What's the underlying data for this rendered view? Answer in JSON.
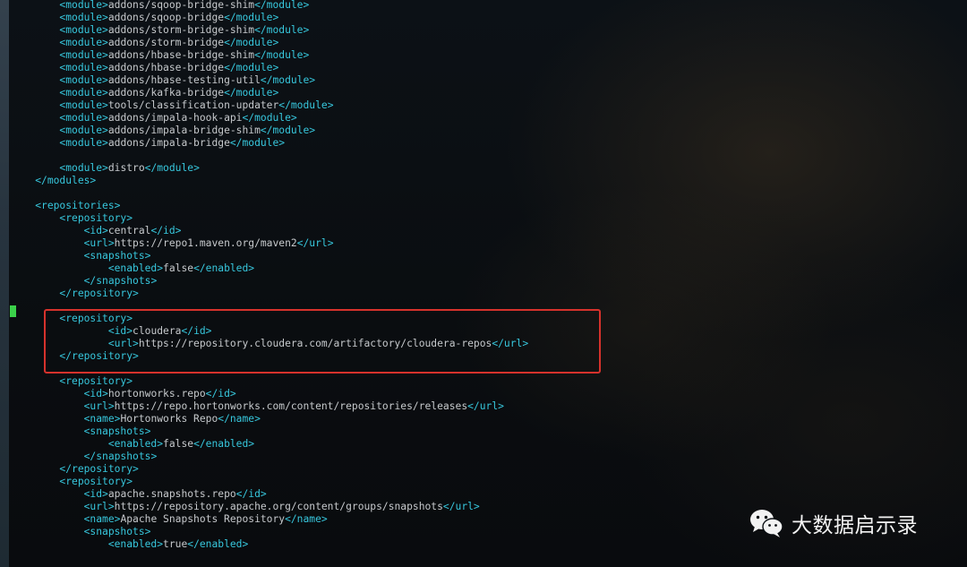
{
  "terminal": {
    "lines": [
      {
        "indent": "        ",
        "parts": [
          [
            "t",
            "<module>"
          ],
          [
            "x",
            "addons/sqoop-bridge-shim"
          ],
          [
            "t",
            "</module>"
          ]
        ]
      },
      {
        "indent": "        ",
        "parts": [
          [
            "t",
            "<module>"
          ],
          [
            "x",
            "addons/sqoop-bridge"
          ],
          [
            "t",
            "</module>"
          ]
        ]
      },
      {
        "indent": "        ",
        "parts": [
          [
            "t",
            "<module>"
          ],
          [
            "x",
            "addons/storm-bridge-shim"
          ],
          [
            "t",
            "</module>"
          ]
        ]
      },
      {
        "indent": "        ",
        "parts": [
          [
            "t",
            "<module>"
          ],
          [
            "x",
            "addons/storm-bridge"
          ],
          [
            "t",
            "</module>"
          ]
        ]
      },
      {
        "indent": "        ",
        "parts": [
          [
            "t",
            "<module>"
          ],
          [
            "x",
            "addons/hbase-bridge-shim"
          ],
          [
            "t",
            "</module>"
          ]
        ]
      },
      {
        "indent": "        ",
        "parts": [
          [
            "t",
            "<module>"
          ],
          [
            "x",
            "addons/hbase-bridge"
          ],
          [
            "t",
            "</module>"
          ]
        ]
      },
      {
        "indent": "        ",
        "parts": [
          [
            "t",
            "<module>"
          ],
          [
            "x",
            "addons/hbase-testing-util"
          ],
          [
            "t",
            "</module>"
          ]
        ]
      },
      {
        "indent": "        ",
        "parts": [
          [
            "t",
            "<module>"
          ],
          [
            "x",
            "addons/kafka-bridge"
          ],
          [
            "t",
            "</module>"
          ]
        ]
      },
      {
        "indent": "        ",
        "parts": [
          [
            "t",
            "<module>"
          ],
          [
            "x",
            "tools/classification-updater"
          ],
          [
            "t",
            "</module>"
          ]
        ]
      },
      {
        "indent": "        ",
        "parts": [
          [
            "t",
            "<module>"
          ],
          [
            "x",
            "addons/impala-hook-api"
          ],
          [
            "t",
            "</module>"
          ]
        ]
      },
      {
        "indent": "        ",
        "parts": [
          [
            "t",
            "<module>"
          ],
          [
            "x",
            "addons/impala-bridge-shim"
          ],
          [
            "t",
            "</module>"
          ]
        ]
      },
      {
        "indent": "        ",
        "parts": [
          [
            "t",
            "<module>"
          ],
          [
            "x",
            "addons/impala-bridge"
          ],
          [
            "t",
            "</module>"
          ]
        ]
      },
      {
        "indent": "",
        "parts": []
      },
      {
        "indent": "        ",
        "parts": [
          [
            "t",
            "<module>"
          ],
          [
            "x",
            "distro"
          ],
          [
            "t",
            "</module>"
          ]
        ]
      },
      {
        "indent": "    ",
        "parts": [
          [
            "t",
            "</modules>"
          ]
        ]
      },
      {
        "indent": "",
        "parts": []
      },
      {
        "indent": "    ",
        "parts": [
          [
            "t",
            "<repositories>"
          ]
        ]
      },
      {
        "indent": "        ",
        "parts": [
          [
            "t",
            "<repository>"
          ]
        ]
      },
      {
        "indent": "            ",
        "parts": [
          [
            "t",
            "<id>"
          ],
          [
            "x",
            "central"
          ],
          [
            "t",
            "</id>"
          ]
        ]
      },
      {
        "indent": "            ",
        "parts": [
          [
            "t",
            "<url>"
          ],
          [
            "x",
            "https://repo1.maven.org/maven2"
          ],
          [
            "t",
            "</url>"
          ]
        ]
      },
      {
        "indent": "            ",
        "parts": [
          [
            "t",
            "<snapshots>"
          ]
        ]
      },
      {
        "indent": "                ",
        "parts": [
          [
            "t",
            "<enabled>"
          ],
          [
            "x",
            "false"
          ],
          [
            "t",
            "</enabled>"
          ]
        ]
      },
      {
        "indent": "            ",
        "parts": [
          [
            "t",
            "</snapshots>"
          ]
        ]
      },
      {
        "indent": "        ",
        "parts": [
          [
            "t",
            "</repository>"
          ]
        ]
      },
      {
        "indent": "",
        "parts": []
      },
      {
        "indent": "        ",
        "parts": [
          [
            "t",
            "<repository>"
          ]
        ]
      },
      {
        "indent": "                ",
        "parts": [
          [
            "t",
            "<id>"
          ],
          [
            "x",
            "cloudera"
          ],
          [
            "t",
            "</id>"
          ]
        ]
      },
      {
        "indent": "                ",
        "parts": [
          [
            "t",
            "<url>"
          ],
          [
            "x",
            "https://repository.cloudera.com/artifactory/cloudera-repos"
          ],
          [
            "t",
            "</url>"
          ]
        ]
      },
      {
        "indent": "        ",
        "parts": [
          [
            "t",
            "</repository>"
          ]
        ]
      },
      {
        "indent": "",
        "parts": []
      },
      {
        "indent": "        ",
        "parts": [
          [
            "t",
            "<repository>"
          ]
        ]
      },
      {
        "indent": "            ",
        "parts": [
          [
            "t",
            "<id>"
          ],
          [
            "x",
            "hortonworks.repo"
          ],
          [
            "t",
            "</id>"
          ]
        ]
      },
      {
        "indent": "            ",
        "parts": [
          [
            "t",
            "<url>"
          ],
          [
            "x",
            "https://repo.hortonworks.com/content/repositories/releases"
          ],
          [
            "t",
            "</url>"
          ]
        ]
      },
      {
        "indent": "            ",
        "parts": [
          [
            "t",
            "<name>"
          ],
          [
            "x",
            "Hortonworks Repo"
          ],
          [
            "t",
            "</name>"
          ]
        ]
      },
      {
        "indent": "            ",
        "parts": [
          [
            "t",
            "<snapshots>"
          ]
        ]
      },
      {
        "indent": "                ",
        "parts": [
          [
            "t",
            "<enabled>"
          ],
          [
            "x",
            "false"
          ],
          [
            "t",
            "</enabled>"
          ]
        ]
      },
      {
        "indent": "            ",
        "parts": [
          [
            "t",
            "</snapshots>"
          ]
        ]
      },
      {
        "indent": "        ",
        "parts": [
          [
            "t",
            "</repository>"
          ]
        ]
      },
      {
        "indent": "        ",
        "parts": [
          [
            "t",
            "<repository>"
          ]
        ]
      },
      {
        "indent": "            ",
        "parts": [
          [
            "t",
            "<id>"
          ],
          [
            "x",
            "apache.snapshots.repo"
          ],
          [
            "t",
            "</id>"
          ]
        ]
      },
      {
        "indent": "            ",
        "parts": [
          [
            "t",
            "<url>"
          ],
          [
            "x",
            "https://repository.apache.org/content/groups/snapshots"
          ],
          [
            "t",
            "</url>"
          ]
        ]
      },
      {
        "indent": "            ",
        "parts": [
          [
            "t",
            "<name>"
          ],
          [
            "x",
            "Apache Snapshots Repository"
          ],
          [
            "t",
            "</name>"
          ]
        ]
      },
      {
        "indent": "            ",
        "parts": [
          [
            "t",
            "<snapshots>"
          ]
        ]
      },
      {
        "indent": "                ",
        "parts": [
          [
            "t",
            "<enabled>"
          ],
          [
            "x",
            "true"
          ],
          [
            "t",
            "</enabled>"
          ]
        ]
      }
    ]
  },
  "watermark": {
    "icon": "wechat-icon",
    "text": "大数据启示录"
  },
  "colors": {
    "tag": "#37c7dd",
    "text": "#c6c9cc",
    "cursor": "#3bd14a",
    "highlight_border": "#d6322c"
  }
}
